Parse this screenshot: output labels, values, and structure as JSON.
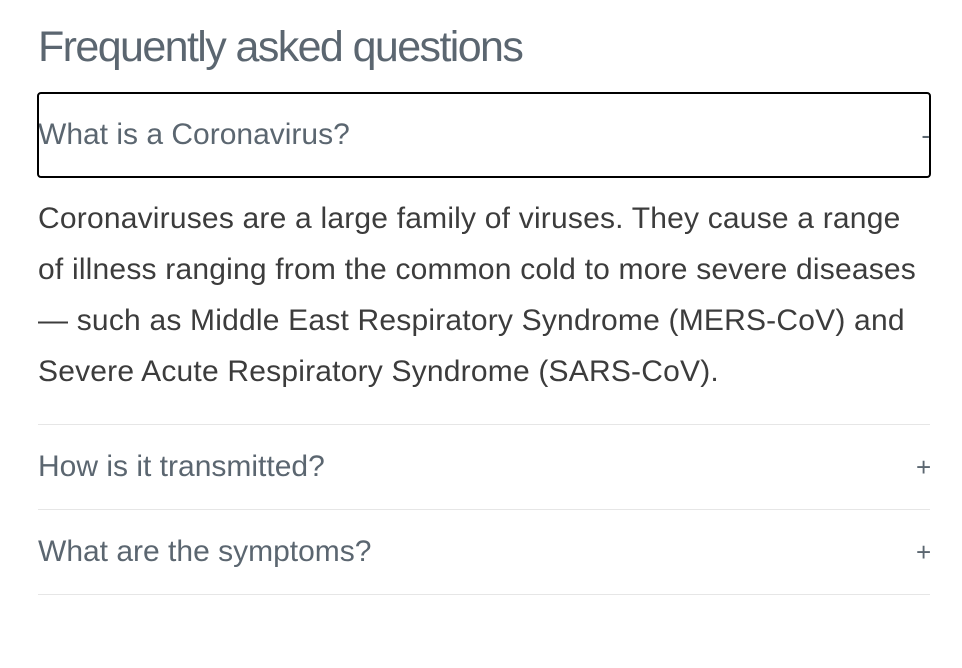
{
  "page": {
    "title": "Frequently asked questions"
  },
  "faq": {
    "items": [
      {
        "question": "What is a Coronavirus?",
        "toggle": "-",
        "expanded": true,
        "answer": "Coronaviruses are a large family of viruses. They cause a range of illness ranging from the common cold to more severe diseases — such as Middle East Respiratory Syndrome (MERS-CoV) and Severe Acute Respiratory Syndrome (SARS-CoV)."
      },
      {
        "question": "How is it transmitted?",
        "toggle": "+",
        "expanded": false
      },
      {
        "question": "What are the symptoms?",
        "toggle": "+",
        "expanded": false
      }
    ]
  },
  "colors": {
    "heading": "#5b6670",
    "answer_text": "#3c3c3c",
    "divider": "#e6e6e6",
    "focus_outline": "#000000"
  }
}
